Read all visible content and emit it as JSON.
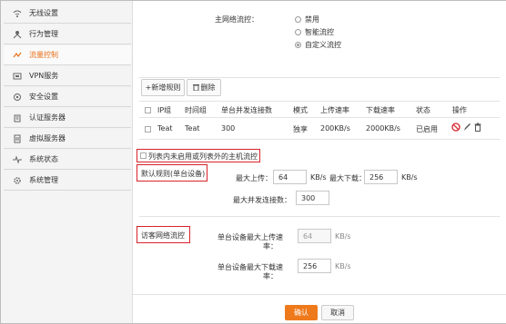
{
  "sidebar": {
    "items": [
      {
        "label": "无线设置",
        "icon": "wifi-icon",
        "active": false
      },
      {
        "label": "行为管理",
        "icon": "behavior-icon",
        "active": false
      },
      {
        "label": "流量控制",
        "icon": "traffic-icon",
        "active": true
      },
      {
        "label": "VPN服务",
        "icon": "vpn-icon",
        "active": false
      },
      {
        "label": "安全设置",
        "icon": "shield-icon",
        "active": false
      },
      {
        "label": "认证服务器",
        "icon": "auth-icon",
        "active": false
      },
      {
        "label": "虚拟服务器",
        "icon": "server-icon",
        "active": false
      },
      {
        "label": "系统状态",
        "icon": "pulse-icon",
        "active": false
      },
      {
        "label": "系统管理",
        "icon": "gear-icon",
        "active": false
      }
    ]
  },
  "flow_control": {
    "label": "主网络流控：",
    "options": [
      "禁用",
      "智能流控",
      "自定义流控"
    ],
    "selected": 2
  },
  "toolbar": {
    "add_label": "+新增规则",
    "delete_label": "删除"
  },
  "table": {
    "headers": [
      "IP组",
      "时间组",
      "单台并发连接数",
      "模式",
      "上传速率",
      "下载速率",
      "状态",
      "操作"
    ],
    "rows": [
      {
        "ip_group": "Teat",
        "time_group": "Teat",
        "concurrent": "300",
        "mode": "独享",
        "upload": "200KB/s",
        "download": "2000KB/s",
        "status": "已启用"
      }
    ]
  },
  "unlisted_note": "列表内未启用或列表外的主机流控",
  "default_rule": {
    "title": "默认规则(单台设备)",
    "max_upload_label": "最大上传：",
    "max_upload_value": "64",
    "upload_unit": "KB/s",
    "max_download_label": "最大下载：",
    "max_download_value": "256",
    "download_unit": "KB/s",
    "max_conn_label": "最大并发连接数：",
    "max_conn_value": "300"
  },
  "guest_flow": {
    "title": "访客网络流控",
    "upload_label_1": "单台设备最大上传速",
    "upload_label_2": "率：",
    "upload_value": "64",
    "upload_unit": "KB/s",
    "download_label_1": "单台设备最大下载速",
    "download_label_2": "率：",
    "download_value": "256",
    "download_unit": "KB/s"
  },
  "footer": {
    "confirm": "确认",
    "cancel": "取消"
  },
  "colors": {
    "accent": "#ee7a1c",
    "highlight_box": "#d6232a",
    "delete_red": "#d6232a"
  }
}
